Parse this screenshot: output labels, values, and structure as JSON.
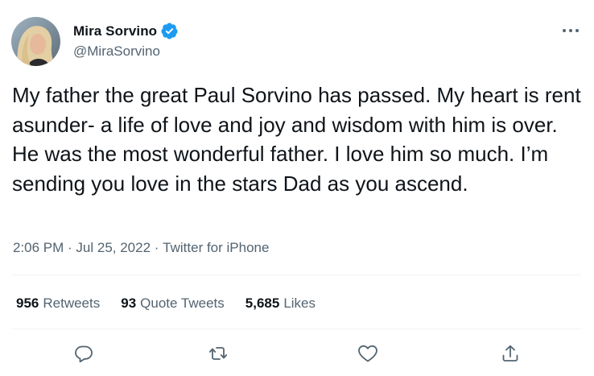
{
  "author": {
    "display_name": "Mira Sorvino",
    "handle": "@MiraSorvino",
    "verified": true,
    "avatar_icon": "profile-photo"
  },
  "tweet": {
    "text": "My father the great Paul Sorvino has passed. My heart is rent asunder- a life of love and joy and wisdom with him is over. He was the most wonderful father. I love him so much. I’m sending you love in the stars Dad as you ascend.",
    "time": "2:06 PM",
    "separator": " · ",
    "date": "Jul 25, 2022",
    "source": "Twitter for iPhone"
  },
  "stats": {
    "retweets": {
      "count": "956",
      "label": "Retweets"
    },
    "quotes": {
      "count": "93",
      "label": "Quote Tweets"
    },
    "likes": {
      "count": "5,685",
      "label": "Likes"
    }
  },
  "actions": {
    "reply_icon": "reply-icon",
    "retweet_icon": "retweet-icon",
    "like_icon": "heart-icon",
    "share_icon": "share-icon"
  },
  "colors": {
    "text": "#0f1419",
    "secondary": "#536471",
    "verified": "#1d9bf0",
    "divider": "#eff3f4"
  }
}
